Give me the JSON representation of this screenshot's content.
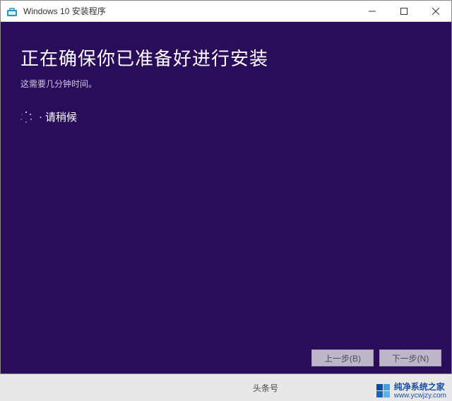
{
  "titlebar": {
    "title": "Windows 10 安装程序"
  },
  "content": {
    "heading": "正在确保你已准备好进行安装",
    "subtext": "这需要几分钟时间。",
    "wait_bullet": "·",
    "wait_label": "请稍候"
  },
  "buttons": {
    "back": "上一步(B)",
    "next": "下一步(N)"
  },
  "watermark": {
    "toutiao": "头条号",
    "brand_main": "纯净系统之家",
    "brand_url": "www.ycwjzy.com"
  },
  "colors": {
    "content_bg": "#2a0d5a",
    "logo_blue1": "#0a4ea3",
    "logo_blue2": "#3fa0e6",
    "logo_blue3": "#1565c0",
    "logo_blue4": "#58b1f0"
  }
}
